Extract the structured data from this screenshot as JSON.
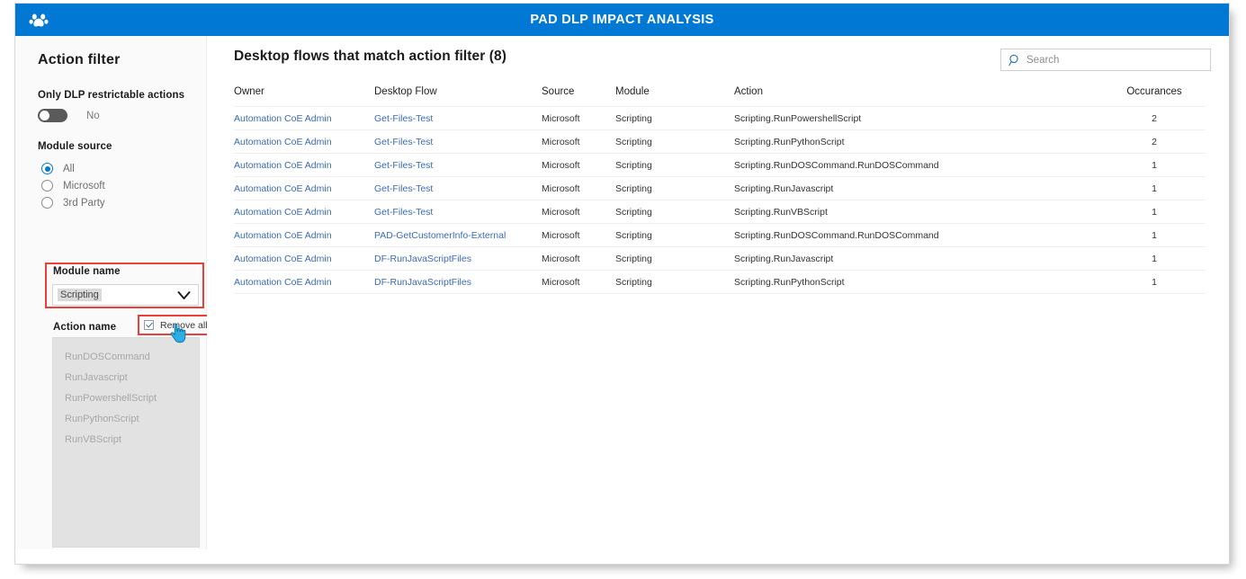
{
  "header": {
    "title": "PAD DLP IMPACT ANALYSIS",
    "logo_icon": "power-automate-desktop-icon",
    "background": "#0078d4"
  },
  "sidebar": {
    "title": "Action filter",
    "dlp_toggle": {
      "label": "Only DLP restrictable actions",
      "value": "No",
      "checked": false
    },
    "module_source": {
      "label": "Module source",
      "selected": "All",
      "options": [
        "All",
        "Microsoft",
        "3rd Party"
      ]
    },
    "module_name": {
      "label": "Module name",
      "value": "Scripting",
      "chevron_icon": "chevron-down-icon",
      "highlight_color": "#e8413a"
    },
    "action_name": {
      "label": "Action name",
      "remove_all_label": "Remove all",
      "remove_all_checked": true,
      "items": [
        "RunDOSCommand",
        "RunJavascript",
        "RunPowershellScript",
        "RunPythonScript",
        "RunVBScript"
      ]
    }
  },
  "main": {
    "title": "Desktop flows that match action filter (8)",
    "search": {
      "placeholder": "Search",
      "value": "",
      "icon": "search-icon"
    },
    "table": {
      "columns": [
        "Owner",
        "Desktop Flow",
        "Source",
        "Module",
        "Action",
        "Occurances"
      ],
      "rows": [
        {
          "owner": "Automation CoE Admin",
          "flow": "Get-Files-Test",
          "source": "Microsoft",
          "module": "Scripting",
          "action": "Scripting.RunPowershellScript",
          "occurances": "2"
        },
        {
          "owner": "Automation CoE Admin",
          "flow": "Get-Files-Test",
          "source": "Microsoft",
          "module": "Scripting",
          "action": "Scripting.RunPythonScript",
          "occurances": "2"
        },
        {
          "owner": "Automation CoE Admin",
          "flow": "Get-Files-Test",
          "source": "Microsoft",
          "module": "Scripting",
          "action": "Scripting.RunDOSCommand.RunDOSCommand",
          "occurances": "1"
        },
        {
          "owner": "Automation CoE Admin",
          "flow": "Get-Files-Test",
          "source": "Microsoft",
          "module": "Scripting",
          "action": "Scripting.RunJavascript",
          "occurances": "1"
        },
        {
          "owner": "Automation CoE Admin",
          "flow": "Get-Files-Test",
          "source": "Microsoft",
          "module": "Scripting",
          "action": "Scripting.RunVBScript",
          "occurances": "1"
        },
        {
          "owner": "Automation CoE Admin",
          "flow": "PAD-GetCustomerInfo-External",
          "source": "Microsoft",
          "module": "Scripting",
          "action": "Scripting.RunDOSCommand.RunDOSCommand",
          "occurances": "1"
        },
        {
          "owner": "Automation CoE Admin",
          "flow": "DF-RunJavaScriptFiles",
          "source": "Microsoft",
          "module": "Scripting",
          "action": "Scripting.RunJavascript",
          "occurances": "1"
        },
        {
          "owner": "Automation CoE Admin",
          "flow": "DF-RunJavaScriptFiles",
          "source": "Microsoft",
          "module": "Scripting",
          "action": "Scripting.RunPythonScript",
          "occurances": "1"
        }
      ]
    }
  }
}
